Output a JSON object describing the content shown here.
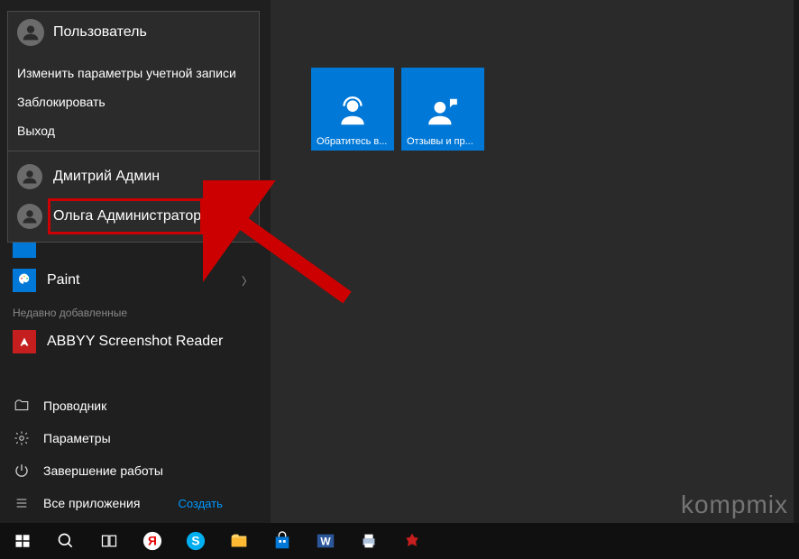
{
  "user_popup": {
    "current_user": "Пользователь",
    "change_settings": "Изменить параметры учетной записи",
    "lock": "Заблокировать",
    "sign_out": "Выход",
    "users": [
      {
        "name": "Дмитрий Админ"
      },
      {
        "name": "Ольга Администратор"
      }
    ]
  },
  "apps": {
    "paint": "Paint",
    "recently_added_label": "Недавно добавленные",
    "abbyy": "ABBYY Screenshot Reader"
  },
  "bottom_menu": {
    "explorer": "Проводник",
    "settings": "Параметры",
    "power": "Завершение работы",
    "all_apps": "Все приложения",
    "create": "Создать"
  },
  "tiles": [
    {
      "label": "Обратитесь в..."
    },
    {
      "label": "Отзывы и пр..."
    }
  ],
  "watermark": "kompmix"
}
